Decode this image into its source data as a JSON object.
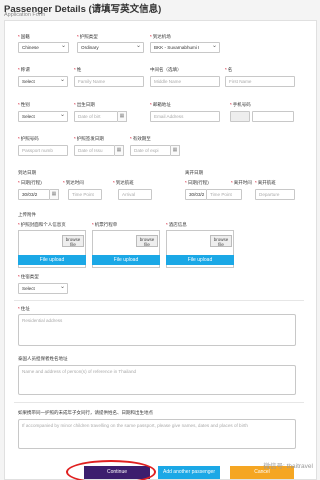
{
  "header": {
    "title": "Passenger Details (请填写英文信息)",
    "subtitle": "Application Form"
  },
  "row1": {
    "nationality_label": "国籍",
    "nationality_value": "Chinese",
    "passport_type_label": "护照类型",
    "passport_type_value": "Ordinary",
    "arrival_airport_label": "到达机场",
    "arrival_airport_value": "BKK - Suvarnabhumi I"
  },
  "row2": {
    "title_label": "称谓",
    "title_value": "Select",
    "surname_label": "姓",
    "surname_placeholder": "Family Name",
    "middle_label": "中间名（选填）",
    "middle_placeholder": "Middle Name",
    "given_label": "名",
    "given_placeholder": "First Name"
  },
  "row3": {
    "gender_label": "性别",
    "gender_value": "Select",
    "dob_label": "出生日期",
    "dob_placeholder": "Date of birt",
    "email_label": "邮箱地址",
    "email_placeholder": "Email Address",
    "phone_label": "手机号码"
  },
  "row4": {
    "passport_no_label": "护照号码",
    "passport_no_placeholder": "Passport numb",
    "issue_label": "护照签发日期",
    "issue_placeholder": "Date of Issu",
    "expiry_label": "有效期至",
    "expiry_placeholder": "Date of expi"
  },
  "travel": {
    "arrival_section": "到达日期",
    "departure_section": "离开日期",
    "arr_date_label": "日期(行程)",
    "arr_date_value": "30/03/2",
    "arr_time_label": "到达时间",
    "arr_time_placeholder": "Time Point",
    "arr_flight_label": "到达航班",
    "arr_flight_placeholder": "Arrival",
    "dep_date_label": "日期(行程)",
    "dep_date_value": "30/03/2",
    "dep_time_label": "离开时间",
    "dep_time_placeholder": "Time Point",
    "dep_flight_label": "离开航班",
    "dep_flight_placeholder": "Departure"
  },
  "uploads": {
    "section": "上传附件",
    "u1_label": "护照封面和个人信息页",
    "u2_label": "机票行程单",
    "u3_label": "酒店信息",
    "browse": "browse file",
    "button": "File upload"
  },
  "residence": {
    "type_label": "住宿类型",
    "type_value": "Select",
    "address_label": "住址",
    "address_placeholder": "Residential address"
  },
  "reference": {
    "label": "泰国人员担保者姓名地址",
    "placeholder": "Name and address of person(s) of reference in Thailand"
  },
  "minors": {
    "label": "如果携带同一护照的未成年子女同行，请提供姓名、日期和出生地点",
    "placeholder": "If accompanied by minor children travelling on the same passport, please give names, dates and places of birth"
  },
  "actions": {
    "continue": "Continue",
    "add": "Add another passenger",
    "cancel": "Cancel"
  },
  "watermark": "微信号: thaitravel",
  "colors": {
    "purple": "#3c1e6e",
    "blue": "#1ba8e6",
    "orange": "#f5a623",
    "red_highlight": "#e02020"
  }
}
